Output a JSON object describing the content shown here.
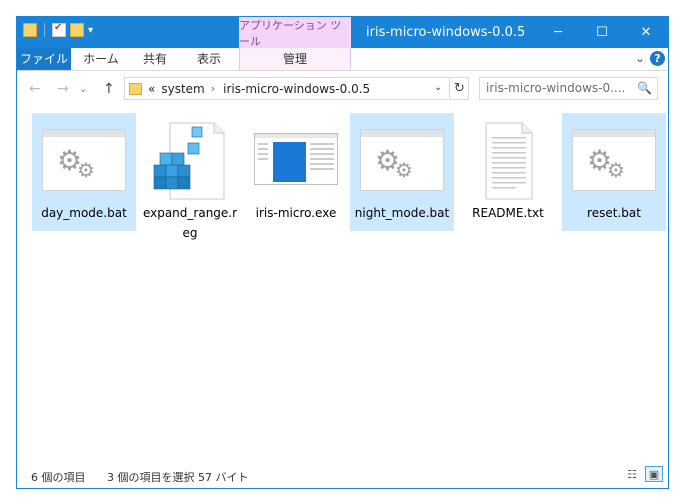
{
  "window": {
    "title": "iris-micro-windows-0.0.5",
    "contextual_tab": "アプリケーション ツール",
    "controls": {
      "minimize": "─",
      "maximize": "☐",
      "close": "✕"
    }
  },
  "ribbon": {
    "tabs": [
      "ファイル",
      "ホーム",
      "共有",
      "表示"
    ],
    "contextual_sub_tab": "管理",
    "expand": "⌄",
    "help": "?"
  },
  "nav": {
    "back": "←",
    "forward": "→",
    "recent": "⌄",
    "up": "↑",
    "overflow": "«",
    "breadcrumb": [
      "system",
      "iris-micro-windows-0.0.5"
    ],
    "separator": "›",
    "refresh": "↻",
    "search_placeholder": "iris-micro-windows-0....",
    "search_icon": "🔍"
  },
  "files": [
    {
      "name": "day_mode.bat",
      "icon": "batch-file-icon",
      "selected": true
    },
    {
      "name": "expand_range.reg",
      "icon": "registry-file-icon",
      "selected": false
    },
    {
      "name": "iris-micro.exe",
      "icon": "application-icon",
      "selected": false
    },
    {
      "name": "night_mode.bat",
      "icon": "batch-file-icon",
      "selected": true
    },
    {
      "name": "README.txt",
      "icon": "text-file-icon",
      "selected": false
    },
    {
      "name": "reset.bat",
      "icon": "batch-file-icon",
      "selected": true
    }
  ],
  "status": {
    "item_count": "6 個の項目",
    "selection": "3 個の項目を選択  57 バイト",
    "details_view": "☷",
    "icons_view": "▣"
  },
  "colors": {
    "title_bar": "#1883d7",
    "file_tab": "#1979ca",
    "selection": "#cce8ff",
    "contextual": "#f3d5f7"
  }
}
